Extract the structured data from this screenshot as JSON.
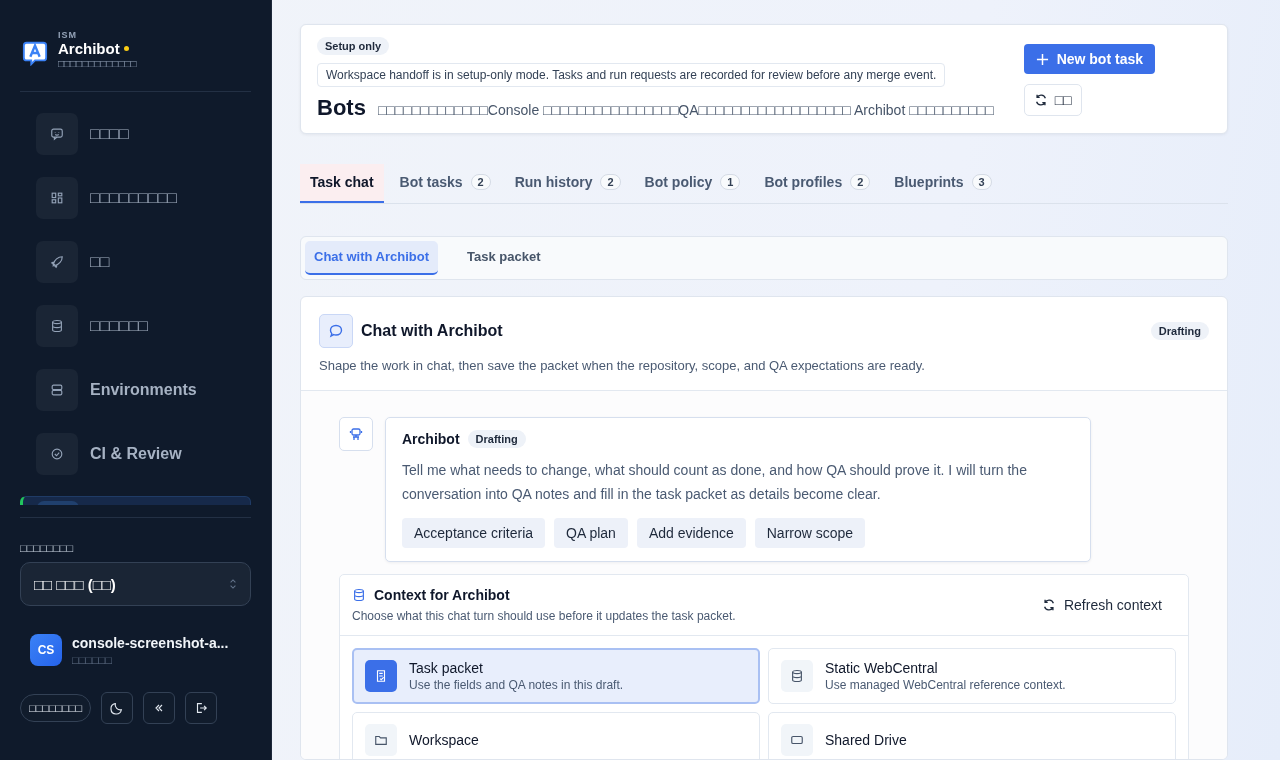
{
  "sidebar": {
    "brand": {
      "eyebrow": "ISM",
      "name": "Archibot",
      "tagline": "□□□□□□□□□□□□□",
      "online": true
    },
    "items": [
      {
        "label": "□□□□",
        "selected": false
      },
      {
        "label": "□□□□□□□□□",
        "selected": false
      },
      {
        "label": "□□",
        "selected": false
      },
      {
        "label": "□□□□□□",
        "selected": false
      },
      {
        "label": "Environments",
        "selected": false
      },
      {
        "label": "CI & Review",
        "selected": false
      },
      {
        "selected": true
      }
    ],
    "workspace_label": "□□□□□□□□",
    "workspace_select": {
      "value": "□□ □□□ (□□)"
    },
    "user": {
      "initials": "CS",
      "name": "console-screenshot-a...",
      "role": "□□□□□□"
    },
    "footer": {
      "language": "□□□□□□□□"
    }
  },
  "header": {
    "badge": "Setup only",
    "notice": "Workspace handoff is in setup-only mode. Tasks and run requests are recorded for review before any merge event.",
    "title": "Bots",
    "subtitle": "□□□□□□□□□□□□□Console □□□□□□□□□□□□□□□□QA□□□□□□□□□□□□□□□□□□ Archibot □□□□□□□□□□",
    "primary_button": "New bot task",
    "refresh_button": "□□"
  },
  "tabs": [
    {
      "label": "Task chat",
      "selected": true
    },
    {
      "label": "Bot tasks",
      "count": "2",
      "selected": false
    },
    {
      "label": "Run history",
      "count": "2",
      "selected": false
    },
    {
      "label": "Bot policy",
      "count": "1",
      "selected": false
    },
    {
      "label": "Bot profiles",
      "count": "2",
      "selected": false
    },
    {
      "label": "Blueprints",
      "count": "3",
      "selected": false
    }
  ],
  "subtabs": [
    {
      "label": "Chat with Archibot",
      "selected": true
    },
    {
      "label": "Task packet",
      "selected": false
    }
  ],
  "chat_panel": {
    "title": "Chat with Archibot",
    "status": "Drafting",
    "description": "Shape the work in chat, then save the packet when the repository, scope, and QA expectations are ready.",
    "message": {
      "author": "Archibot",
      "status": "Drafting",
      "text": "Tell me what needs to change, what should count as done, and how QA should prove it. I will turn the conversation into QA notes and fill in the task packet as details become clear.",
      "chips": [
        "Acceptance criteria",
        "QA plan",
        "Add evidence",
        "Narrow scope"
      ]
    },
    "context": {
      "title": "Context for Archibot",
      "description": "Choose what this chat turn should use before it updates the task packet.",
      "refresh_button": "Refresh context",
      "sources": [
        {
          "title": "Task packet",
          "description": "Use the fields and QA notes in this draft.",
          "selected": true
        },
        {
          "title": "Static WebCentral",
          "description": "Use managed WebCentral reference context.",
          "selected": false
        },
        {
          "title": "Workspace",
          "selected": false
        },
        {
          "title": "Shared Drive",
          "selected": false
        }
      ]
    }
  }
}
